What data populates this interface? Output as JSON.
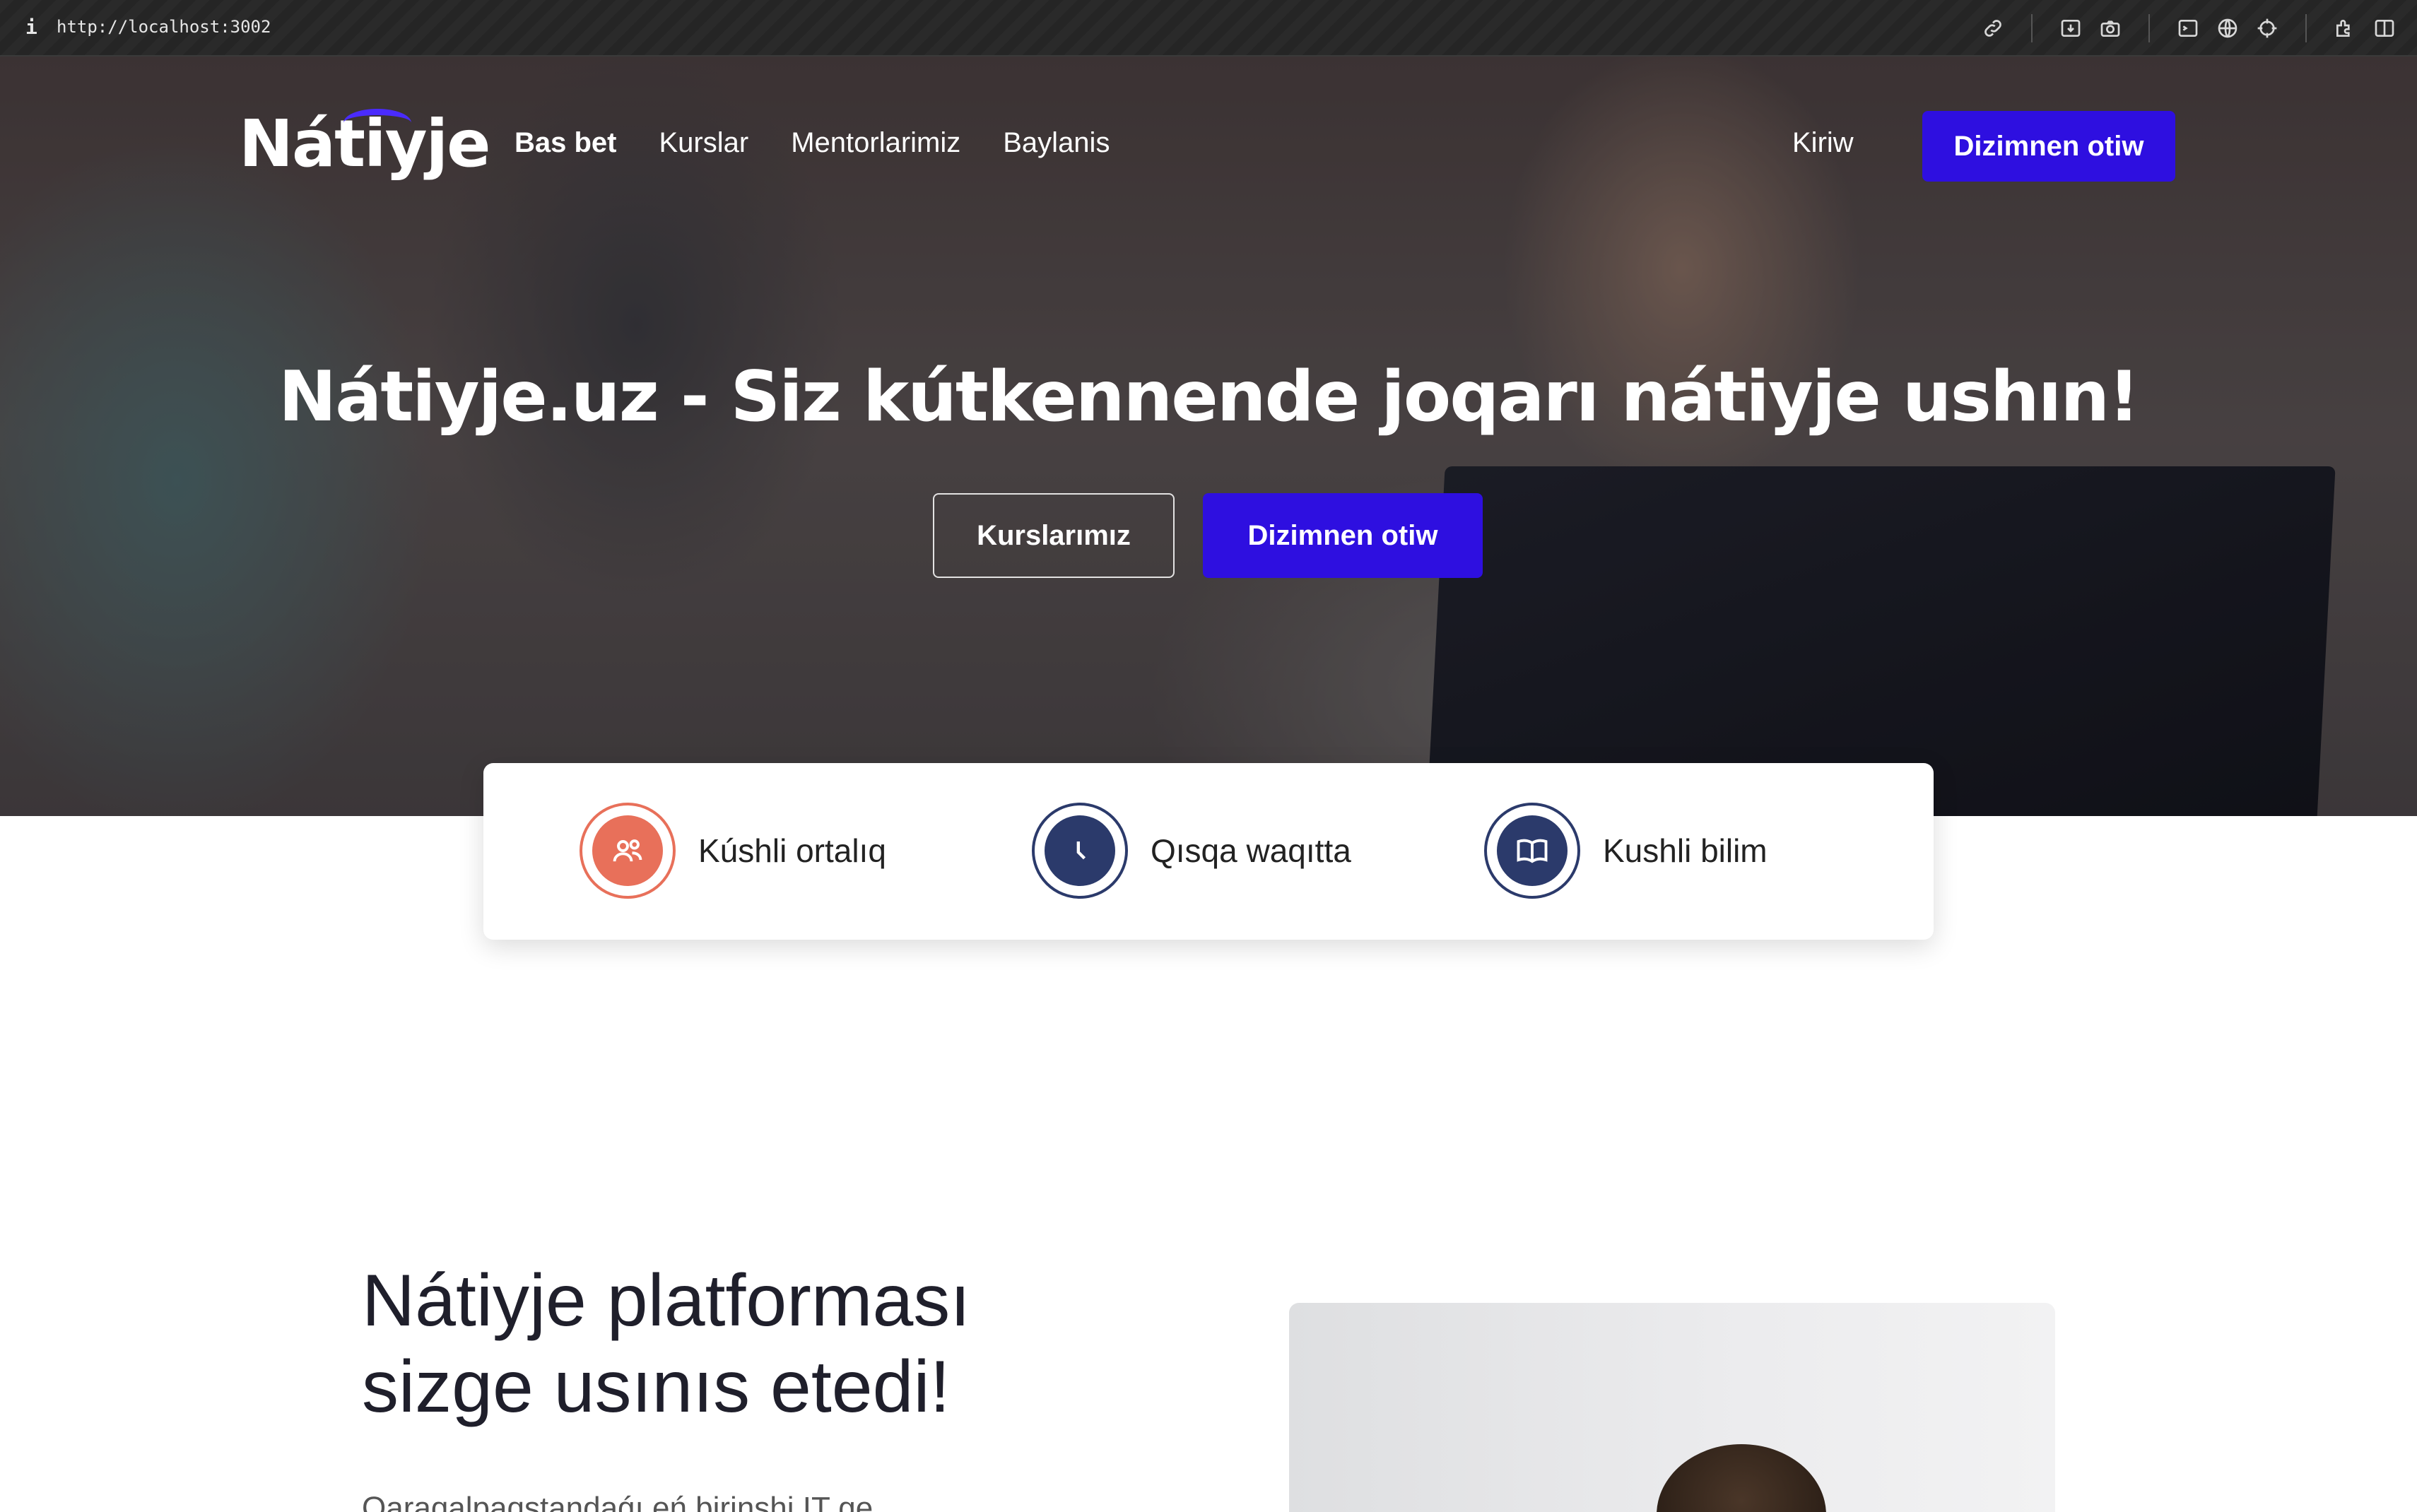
{
  "browser": {
    "info_icon_label": "i",
    "url": "http://localhost:3002",
    "tools": [
      "link-icon",
      "download-icon",
      "camera-icon",
      "terminal-icon",
      "globe-icon",
      "crosshair-icon",
      "extensions-icon",
      "sidebar-icon"
    ]
  },
  "nav": {
    "logo": "Nátiyje",
    "links": [
      "Bas bet",
      "Kurslar",
      "Mentorlarimiz",
      "Baylanis"
    ],
    "active_link": "Bas bet",
    "login": "Kiriw",
    "register": "Dizimnen otiw"
  },
  "hero": {
    "title": "Nátiyje.uz - Siz kútkennende joqarı nátiyje ushın!",
    "button_courses": "Kurslarımız",
    "button_register": "Dizimnen otiw"
  },
  "features": [
    {
      "label": "Kúshli ortalıq",
      "icon": "users-icon",
      "color": "#e8705a"
    },
    {
      "label": "Qısqa waqıtta",
      "icon": "clock-icon",
      "color": "#2b3a6b"
    },
    {
      "label": "Kushli bilim",
      "icon": "book-icon",
      "color": "#2b3a6b"
    }
  ],
  "about": {
    "title_line1": "Nátiyje platforması",
    "title_line2": "sizge usınıs etedi!",
    "text_partial": "Qaraqalpaqstandaǵı eń birinshi IT ge"
  },
  "colors": {
    "primary": "#2e0fe0",
    "accent_red": "#e8705a",
    "navy": "#2b3a6b"
  }
}
